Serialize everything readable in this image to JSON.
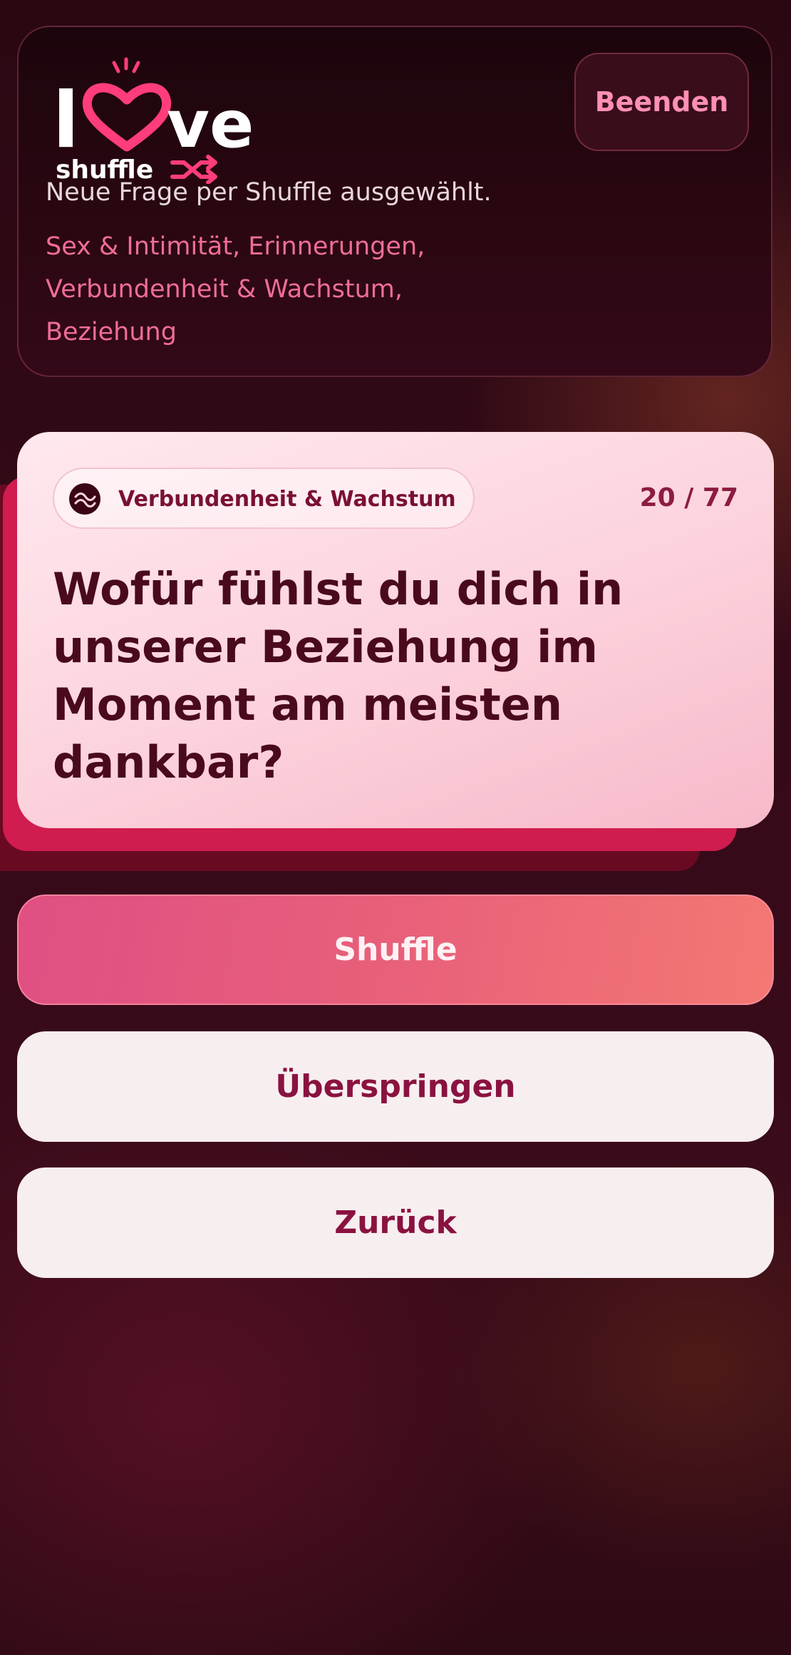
{
  "header": {
    "logo_text": "love shuffle",
    "end_button_label": "Beenden",
    "status_message": "Neue Frage per Shuffle ausgewählt.",
    "selected_categories_line1": "Sex & Intimität, Erinnerungen,",
    "selected_categories_line2": "Verbundenheit & Wachstum,",
    "selected_categories_line3": "Beziehung"
  },
  "question_card": {
    "category": "Verbundenheit & Wachstum",
    "counter": "20 / 77",
    "question": "Wofür fühlst du dich in unserer Beziehung im Moment am meisten dankbar?"
  },
  "actions": {
    "shuffle_label": "Shuffle",
    "skip_label": "Überspringen",
    "back_label": "Zurück"
  },
  "colors": {
    "accent_pink": "#ef6d98",
    "brand_dark": "#4a0a1e",
    "card_bg": "#fcd2dc",
    "shuffle_gradient_start": "#e04f83",
    "shuffle_gradient_end": "#f47873"
  },
  "icons": {
    "category": "wave-icon",
    "logo_heart": "heart-icon",
    "logo_shuffle": "shuffle-arrows-icon"
  }
}
